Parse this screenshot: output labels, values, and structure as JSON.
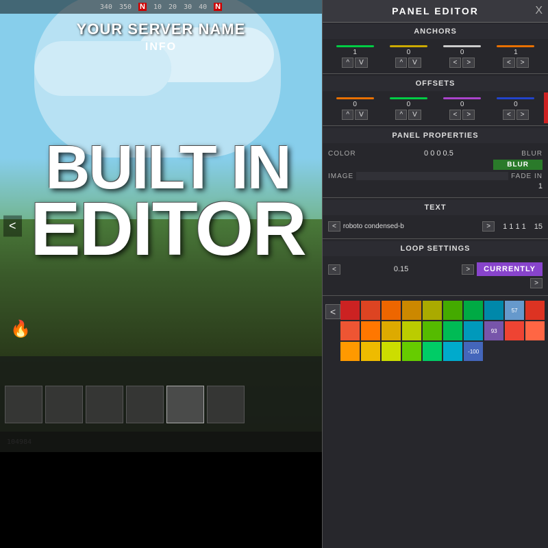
{
  "game": {
    "server_name": "YOUR SERVER NAME",
    "info_text": "INFO",
    "coords": "104984",
    "left_arrow": "<"
  },
  "overlay": {
    "line1": "BUILT IN",
    "line2": "EDITOR"
  },
  "panel_editor": {
    "title": "PANEL EDITOR",
    "close_btn": "X",
    "sections": {
      "anchors": {
        "label": "ANCHORS",
        "sliders": [
          {
            "color": "#00cc44",
            "value": "1"
          },
          {
            "color": "#ccaa00",
            "value": "0"
          },
          {
            "color": "#cccccc",
            "value": "0"
          },
          {
            "color": "#e87000",
            "value": "1"
          }
        ],
        "controls": [
          "^",
          "V",
          "^",
          "V",
          "<",
          ">",
          "<",
          ">"
        ]
      },
      "offsets": {
        "label": "OFFSETS",
        "sliders": [
          {
            "color": "#e87000",
            "value": "0"
          },
          {
            "color": "#00cc44",
            "value": "0"
          },
          {
            "color": "#aa44cc",
            "value": "0"
          },
          {
            "color": "#2244cc",
            "value": "0"
          }
        ],
        "controls": [
          "^",
          "V",
          "^",
          "V",
          "<",
          ">",
          "<",
          ">"
        ]
      },
      "panel_properties": {
        "label": "PANEL PROPERTIES",
        "color_label": "COLOR",
        "color_value": "0 0 0 0.5",
        "blur_label": "BLUR",
        "blur_btn": "BLUR",
        "image_label": "IMAGE",
        "fade_label": "FADE IN",
        "fade_value": "1"
      },
      "text": {
        "label": "TEXT",
        "font_left": "<",
        "font_name": "roboto condensed-b",
        "font_right": ">",
        "text_values": "1 1 1 1",
        "size_value": "15"
      },
      "loop_settings": {
        "label": "LOOP SETTINGS",
        "left_btn": "<",
        "value": "0.15",
        "right_btn": ">",
        "currently_btn": "CURRENTLY",
        "down_btn": ">"
      }
    },
    "color_palette": {
      "left_btn": "<",
      "colors": [
        "#cc2222",
        "#dd4422",
        "#ee6600",
        "#cc8800",
        "#aaaa00",
        "#44aa00",
        "#00aa44",
        "#0088aa",
        "#2255cc",
        "#5522cc",
        "#cc2244",
        "#ee3322",
        "#ff7700",
        "#ddaa00",
        "#bbcc00",
        "#55bb00",
        "#00bb55",
        "#0099bb",
        "#3366dd",
        "#6633dd",
        "#dd3366",
        "#ff4433",
        "#ff9900",
        "#eebb00",
        "#ccdd00",
        "#66cc00",
        "#00cc66",
        "#00aacc",
        "#4477ee",
        "#7744ee",
        "#ee4488",
        "#ff5544",
        "#ffaa00",
        "#ffcc00",
        "#ddee00",
        "#77dd00",
        "#00dd77",
        "#00bbdd",
        "#5588ff",
        "#8855ff",
        "#ff55aa",
        "#ff6655",
        "#ffbb00",
        "#ffdd00",
        "#eeff00",
        "#88ee00",
        "#00ee88",
        "#00ccee",
        "#66aaff",
        "#9966ff",
        "#ff77bb",
        "#ff7766",
        "#ffcc33",
        "#ffee33",
        "#eeff33",
        "#99ff00",
        "#33ff99",
        "#33ddff",
        "#77bbff",
        "#aa88ff",
        "#888888",
        "#999999",
        "#aaaaaa",
        "#bbbbbb",
        "#cccccc",
        "#dddddd",
        {
          "v": "57",
          "bg": "#6699cc"
        },
        {
          "v": "93",
          "bg": "#7755aa"
        },
        {
          "v": "-100",
          "bg": "#4466bb"
        }
      ]
    }
  }
}
